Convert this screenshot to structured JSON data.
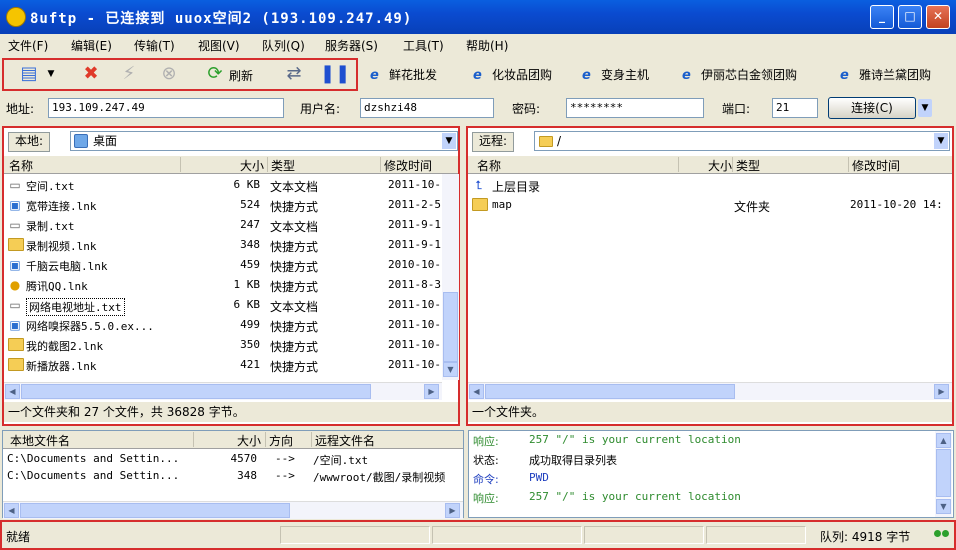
{
  "window": {
    "title": "8uftp - 已连接到 uuox空间2 (193.109.247.49)",
    "controls": {
      "minimize": "_",
      "maximize": "□",
      "close": "✕"
    }
  },
  "menu": [
    "文件(F)",
    "编辑(E)",
    "传输(T)",
    "视图(V)",
    "队列(Q)",
    "服务器(S)",
    "工具(T)",
    "帮助(H)"
  ],
  "toolbar": {
    "refresh_label": "刷新",
    "bookmarks": [
      "鲜花批发",
      "化妆品团购",
      "变身主机",
      "伊丽芯白金领团购",
      "雅诗兰黛团购"
    ]
  },
  "connection": {
    "address_label": "地址:",
    "address_value": "193.109.247.49",
    "user_label": "用户名:",
    "user_value": "dzshzi48",
    "password_label": "密码:",
    "password_value": "********",
    "port_label": "端口:",
    "port_value": "21",
    "connect_label": "连接(C)"
  },
  "local": {
    "label": "本地:",
    "path": "桌面",
    "columns": [
      "名称",
      "大小",
      "类型",
      "修改时间"
    ],
    "files": [
      {
        "name": "空间.txt",
        "size": "6 KB",
        "type": "文本文档",
        "date": "2011-10-",
        "icon": "txt"
      },
      {
        "name": "宽带连接.lnk",
        "size": "524",
        "type": "快捷方式",
        "date": "2011-2-5",
        "icon": "lnk"
      },
      {
        "name": "录制.txt",
        "size": "247",
        "type": "文本文档",
        "date": "2011-9-1",
        "icon": "txt"
      },
      {
        "name": "录制视频.lnk",
        "size": "348",
        "type": "快捷方式",
        "date": "2011-9-1",
        "icon": "folder"
      },
      {
        "name": "千脑云电脑.lnk",
        "size": "459",
        "type": "快捷方式",
        "date": "2010-10-",
        "icon": "lnk"
      },
      {
        "name": "腾讯QQ.lnk",
        "size": "1 KB",
        "type": "快捷方式",
        "date": "2011-8-3",
        "icon": "qq"
      },
      {
        "name": "网络电视地址.txt",
        "size": "6 KB",
        "type": "文本文档",
        "date": "2011-10-",
        "icon": "txt"
      },
      {
        "name": "网络嗅探器5.5.0.ex...",
        "size": "499",
        "type": "快捷方式",
        "date": "2011-10-",
        "icon": "lnk"
      },
      {
        "name": "我的截图2.lnk",
        "size": "350",
        "type": "快捷方式",
        "date": "2011-10-",
        "icon": "folder"
      },
      {
        "name": "新播放器.lnk",
        "size": "421",
        "type": "快捷方式",
        "date": "2011-10-",
        "icon": "folder"
      }
    ],
    "status": "一个文件夹和 27 个文件，共 36828 字节。"
  },
  "remote": {
    "label": "远程:",
    "path": "/",
    "columns": [
      "名称",
      "大小",
      "类型",
      "修改时间"
    ],
    "files": [
      {
        "name": "上层目录",
        "size": "",
        "type": "",
        "date": "",
        "icon": "up"
      },
      {
        "name": "map",
        "size": "",
        "type": "文件夹",
        "date": "2011-10-20 14:",
        "icon": "folder"
      }
    ],
    "status": "一个文件夹。"
  },
  "queue": {
    "columns": [
      "本地文件名",
      "大小",
      "方向",
      "远程文件名"
    ],
    "rows": [
      {
        "local": "C:\\Documents and Settin...",
        "size": "4570",
        "dir": "-->",
        "remote": "/空间.txt"
      },
      {
        "local": "C:\\Documents and Settin...",
        "size": "348",
        "dir": "-->",
        "remote": "/wwwroot/截图/录制视频"
      }
    ]
  },
  "log": [
    {
      "key": "响应:",
      "value": "257 \"/\" is your current location",
      "color": "#2e8b2e"
    },
    {
      "key": "状态:",
      "value": "成功取得目录列表",
      "color": "#000000"
    },
    {
      "key": "命令:",
      "value": "PWD",
      "color": "#1f3fbf"
    },
    {
      "key": "响应:",
      "value": "257 \"/\" is your current location",
      "color": "#2e8b2e"
    }
  ],
  "statusbar": {
    "left": "就绪",
    "queue": "队列: 4918 字节"
  },
  "colors": {
    "highlight": "#d62d2d",
    "titlebar": "#0a4bd0"
  }
}
